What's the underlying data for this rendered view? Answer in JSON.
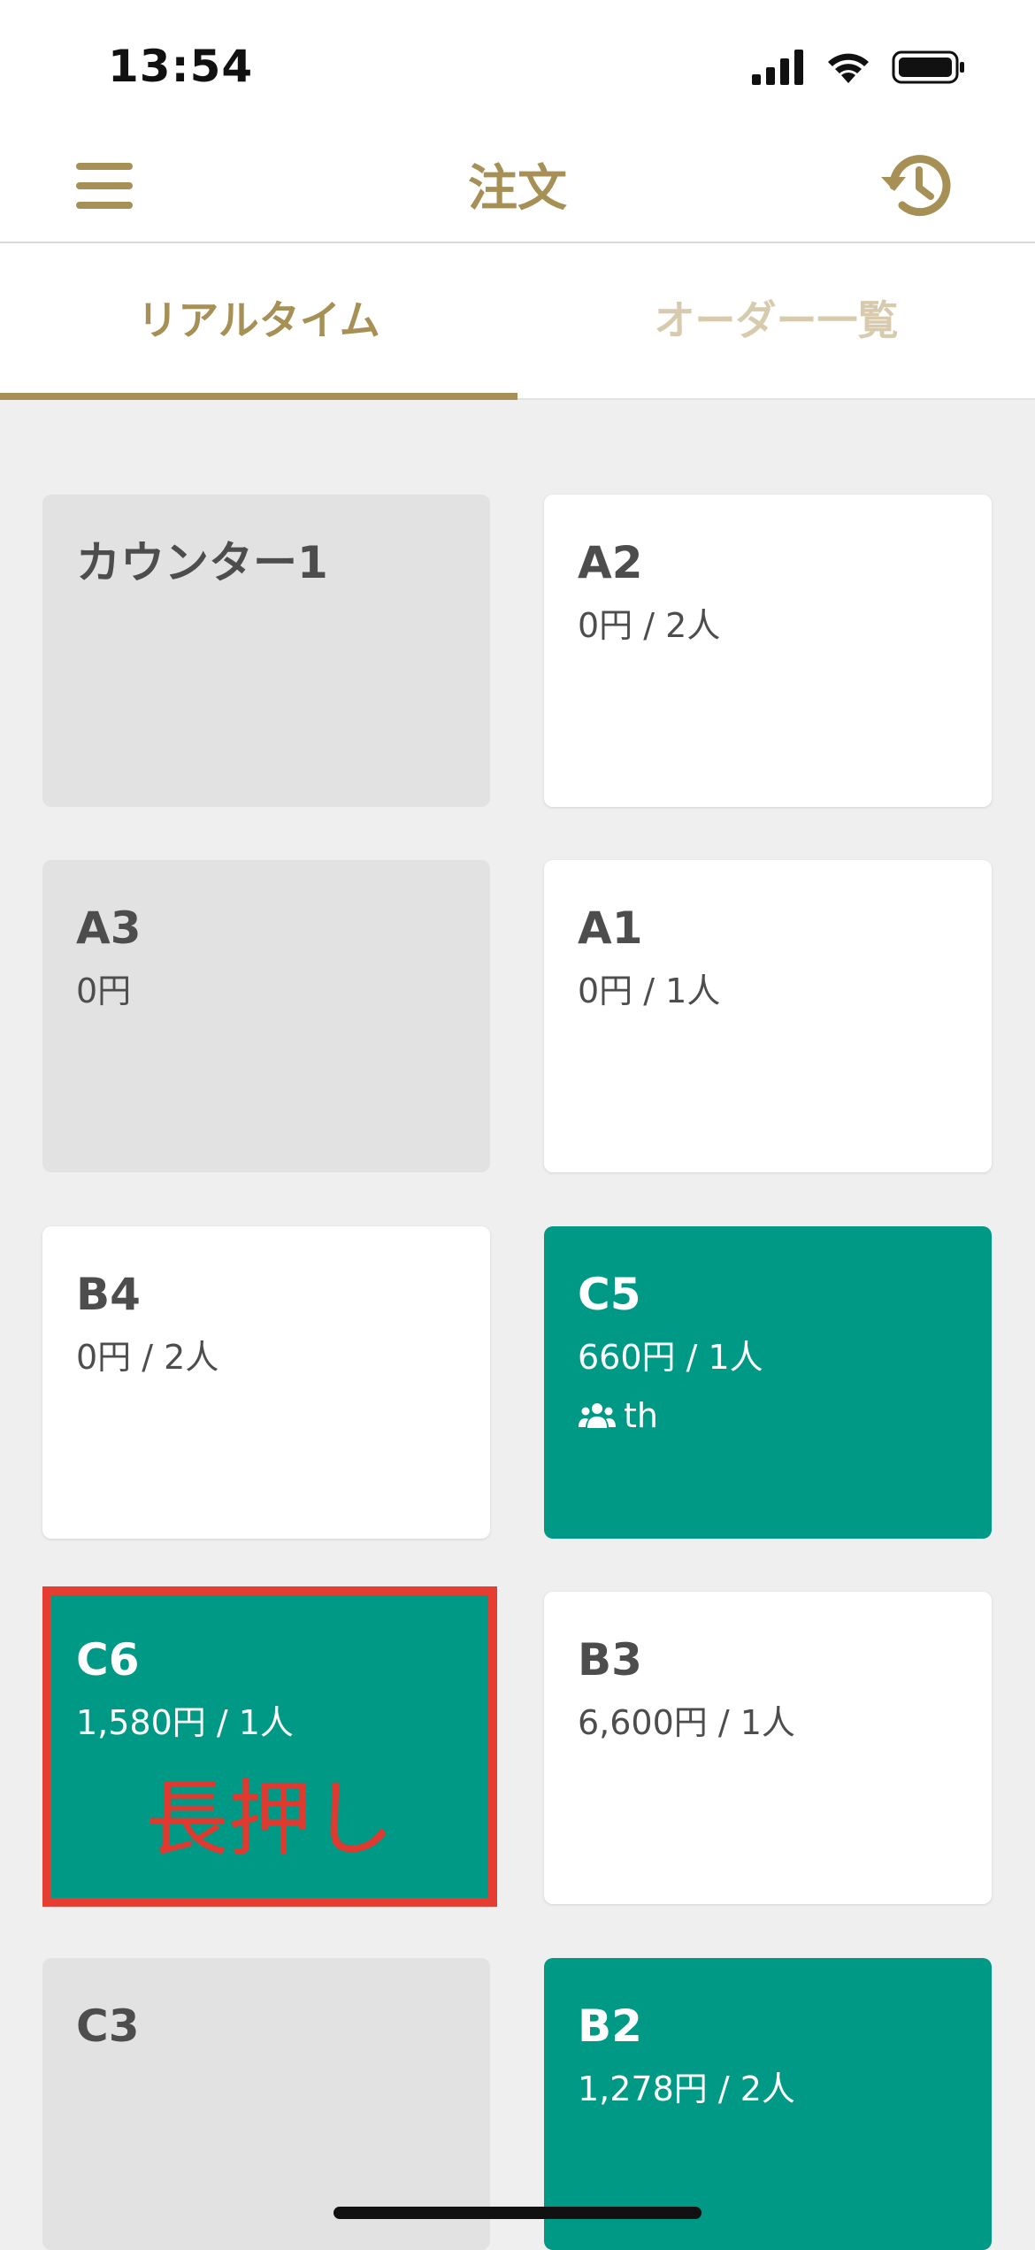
{
  "status_bar": {
    "time": "13:54"
  },
  "header": {
    "title": "注文",
    "menu_icon": "hamburger-icon",
    "history_icon": "history-icon"
  },
  "tabs": [
    {
      "label": "リアルタイム",
      "active": true
    },
    {
      "label": "オーダー一覧",
      "active": false
    }
  ],
  "tables": [
    {
      "name": "カウンター1",
      "detail": "",
      "staff": "",
      "state": "empty"
    },
    {
      "name": "A2",
      "detail": "0円 / 2人",
      "staff": "",
      "state": "seated"
    },
    {
      "name": "A3",
      "detail": "0円",
      "staff": "",
      "state": "empty"
    },
    {
      "name": "A1",
      "detail": "0円 / 1人",
      "staff": "",
      "state": "seated"
    },
    {
      "name": "B4",
      "detail": "0円 / 2人",
      "staff": "",
      "state": "seated"
    },
    {
      "name": "C5",
      "detail": "660円 / 1人",
      "staff": "th",
      "state": "ordered"
    },
    {
      "name": "C6",
      "detail": "1,580円 / 1人",
      "staff": "",
      "state": "ordered"
    },
    {
      "name": "B3",
      "detail": "6,600円 / 1人",
      "staff": "",
      "state": "seated"
    },
    {
      "name": "C3",
      "detail": "",
      "staff": "",
      "state": "empty"
    },
    {
      "name": "B2",
      "detail": "1,278円 / 2人",
      "staff": "",
      "state": "ordered"
    }
  ],
  "annotation": {
    "text": "長押し"
  },
  "colors": {
    "accent": "#a69055",
    "ordered": "#009986",
    "empty": "#e2e2e2",
    "annotation": "#e03a30"
  }
}
